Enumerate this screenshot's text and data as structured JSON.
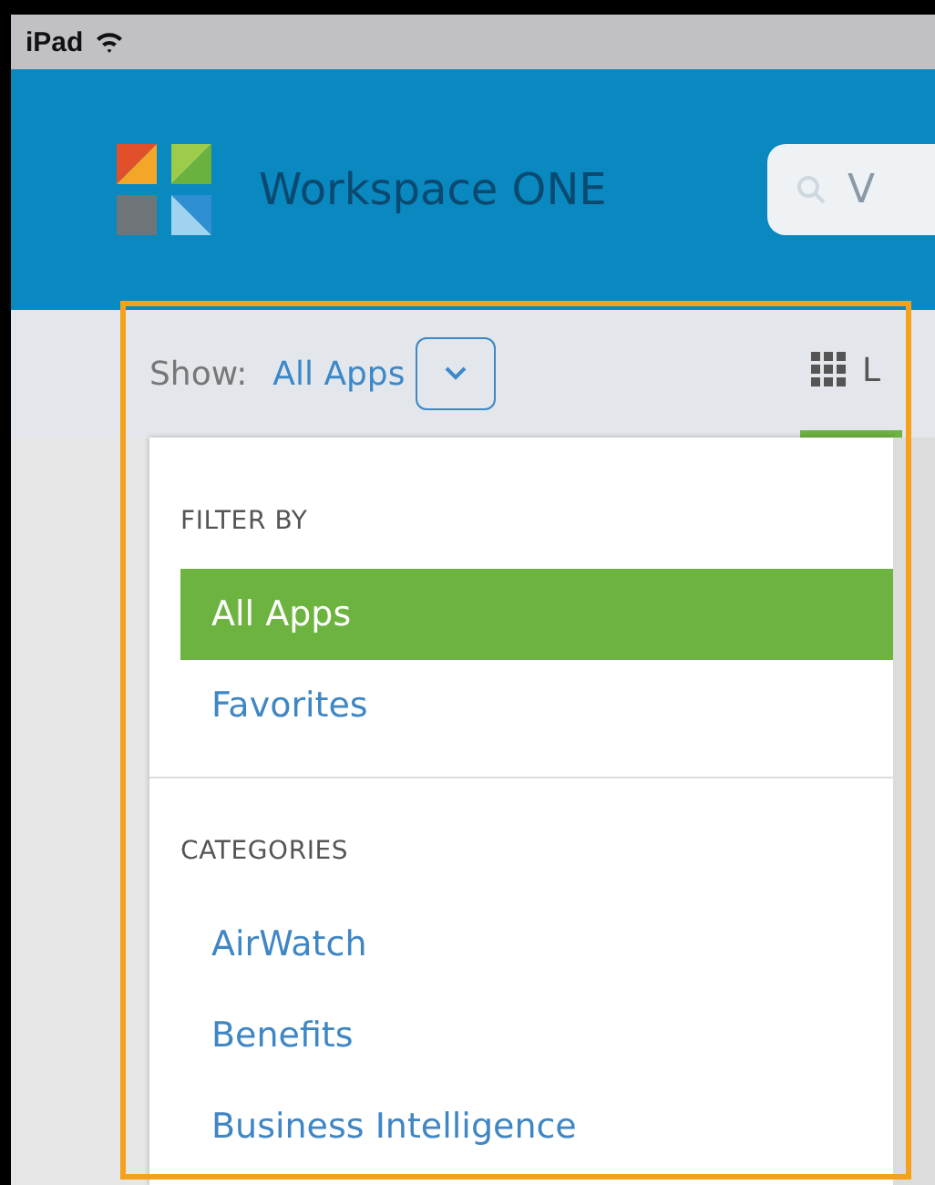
{
  "status_bar": {
    "device": "iPad"
  },
  "header": {
    "title": "Workspace ONE",
    "search": {
      "value": "V"
    }
  },
  "filter_bar": {
    "label": "Show:",
    "value": "All Apps",
    "view_tabs": [
      {
        "label": "L",
        "selected": true
      }
    ]
  },
  "dropdown": {
    "sections": [
      {
        "heading": "FILTER BY",
        "items": [
          {
            "label": "All Apps",
            "selected": true
          },
          {
            "label": "Favorites",
            "selected": false
          }
        ]
      },
      {
        "heading": "CATEGORIES",
        "items": [
          {
            "label": "AirWatch",
            "selected": false
          },
          {
            "label": "Benefits",
            "selected": false
          },
          {
            "label": "Business Intelligence",
            "selected": false
          }
        ]
      }
    ]
  }
}
